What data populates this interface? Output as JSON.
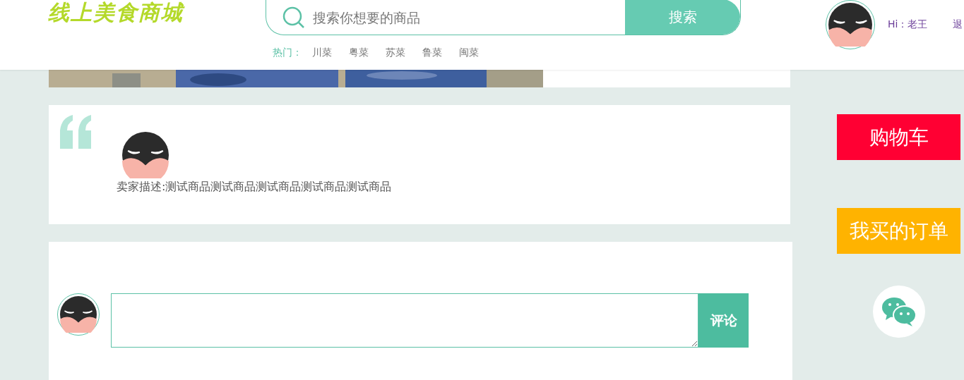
{
  "header": {
    "logo": "线上美食商城",
    "search": {
      "placeholder": "搜索你想要的商品",
      "button": "搜索"
    },
    "hot": {
      "label": "热门：",
      "items": [
        "川菜",
        "粤菜",
        "苏菜",
        "鲁菜",
        "闽菜"
      ]
    },
    "user": {
      "greeting": "Hi：老王",
      "logout": "退"
    }
  },
  "seller": {
    "description": "卖家描述:测试商品测试商品测试商品测试商品测试商品"
  },
  "comment": {
    "button": "评论"
  },
  "side": {
    "buttons": [
      {
        "label": "购物车",
        "color": "#ff0033"
      },
      {
        "label": "我买的订单",
        "color": "#ffb300"
      }
    ]
  }
}
